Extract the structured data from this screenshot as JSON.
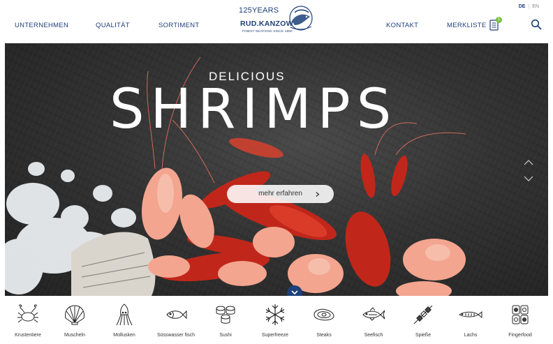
{
  "header": {
    "nav_left": [
      "UNTERNEHMEN",
      "QUALITÄT",
      "SORTIMENT"
    ],
    "nav_right": [
      "KONTAKT",
      "MERKLISTE"
    ],
    "merkliste_count": "1",
    "lang": {
      "de": "DE",
      "sep": "|",
      "en": "EN"
    },
    "logo": {
      "years": "125YEARS",
      "name": "RUD.KANZOW",
      "tagline": "FINEST SEAFOOD SINCE 1890"
    }
  },
  "hero": {
    "subtitle": "DELICIOUS",
    "title": "SHRIMPS",
    "cta_label": "mehr erfahren",
    "cta_icon": "chevron-right-icon"
  },
  "categories": [
    {
      "label": "Krustentiere",
      "icon": "crab-icon"
    },
    {
      "label": "Muscheln",
      "icon": "shell-icon"
    },
    {
      "label": "Mollusken",
      "icon": "squid-icon"
    },
    {
      "label": "Süsswasser fisch",
      "icon": "fish-icon"
    },
    {
      "label": "Sushi",
      "icon": "sushi-icon"
    },
    {
      "label": "Superfreeze",
      "icon": "snowflake-icon"
    },
    {
      "label": "Steaks",
      "icon": "steak-icon"
    },
    {
      "label": "Seefisch",
      "icon": "sea-fish-icon"
    },
    {
      "label": "Spieße",
      "icon": "skewer-icon"
    },
    {
      "label": "Lachs",
      "icon": "salmon-icon"
    },
    {
      "label": "Fingerfood",
      "icon": "fingerfood-icon"
    }
  ],
  "colors": {
    "brand": "#1d3f7a",
    "badge": "#7bc043"
  }
}
